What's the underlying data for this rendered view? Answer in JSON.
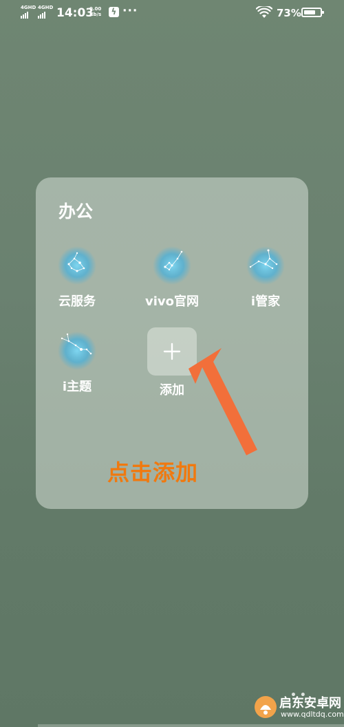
{
  "status_bar": {
    "network1": "4GHD",
    "network2": "4GHD",
    "time": "14:03",
    "speed_value": "0.00",
    "speed_unit": "Kb/s",
    "more_dots": "···",
    "battery_percent": "73%",
    "battery_level": 0.73
  },
  "folder": {
    "title": "办公",
    "apps": [
      {
        "label": "云服务",
        "icon": "constellation-icon"
      },
      {
        "label": "vivo官网",
        "icon": "constellation-icon"
      },
      {
        "label": "i管家",
        "icon": "constellation-icon"
      },
      {
        "label": "i主题",
        "icon": "constellation-icon"
      }
    ],
    "add_label": "添加"
  },
  "annotation": {
    "callout_text": "点击添加",
    "callout_color": "#f0790f",
    "arrow_color": "#f26f3a"
  },
  "watermark": {
    "text": "启东安卓网",
    "url": "www.qdltdq.com"
  }
}
